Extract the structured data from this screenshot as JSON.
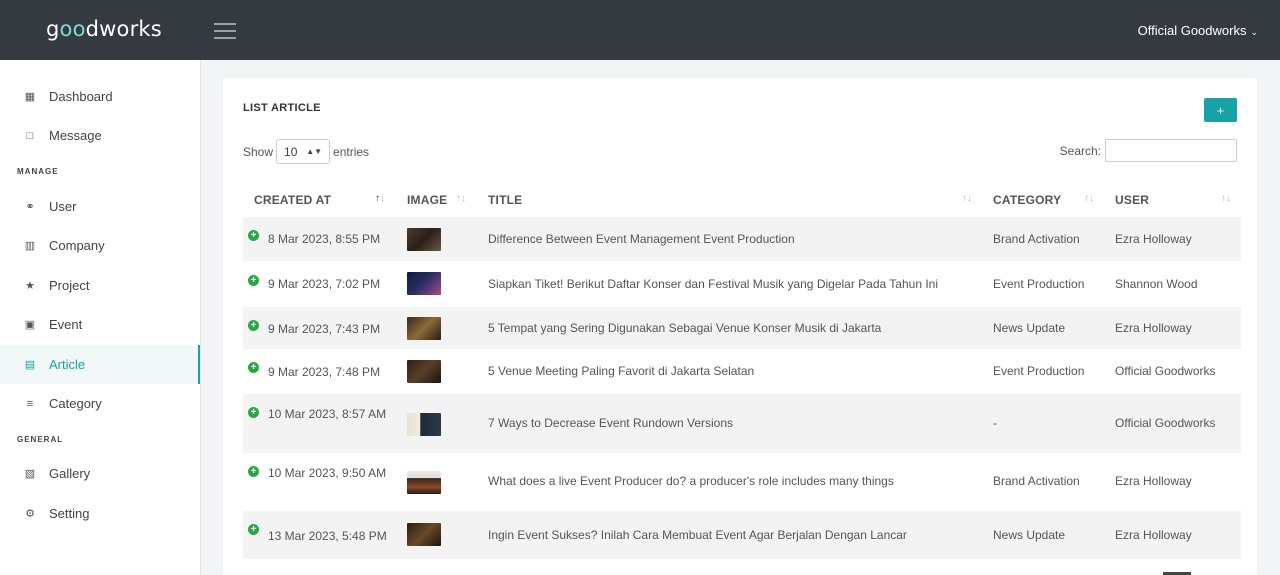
{
  "app": {
    "logo_prefix": "g",
    "logo_oo": "oo",
    "logo_suffix": "dworks",
    "account_name": "Official Goodworks"
  },
  "sidebar": {
    "items_top": [
      {
        "label": "Dashboard",
        "icon": "dashboard-icon"
      },
      {
        "label": "Message",
        "icon": "message-icon"
      }
    ],
    "manage_label": "MANAGE",
    "manage_items": [
      {
        "label": "User",
        "icon": "user-icon"
      },
      {
        "label": "Company",
        "icon": "company-icon"
      },
      {
        "label": "Project",
        "icon": "star-icon"
      },
      {
        "label": "Event",
        "icon": "calendar-icon"
      },
      {
        "label": "Article",
        "icon": "article-icon",
        "active": true
      },
      {
        "label": "Category",
        "icon": "list-icon"
      }
    ],
    "general_label": "GENERAL",
    "general_items": [
      {
        "label": "Gallery",
        "icon": "gallery-icon"
      },
      {
        "label": "Setting",
        "icon": "gear-icon"
      }
    ]
  },
  "main": {
    "title": "LIST ARTICLE",
    "add_label": "+",
    "show_label": "Show",
    "entries_value": "10",
    "entries_label": "entries",
    "search_label": "Search:",
    "search_value": "",
    "columns": [
      "CREATED AT",
      "IMAGE",
      "TITLE",
      "CATEGORY",
      "USER"
    ],
    "rows": [
      {
        "created_at": "8 Mar 2023, 8:55 PM",
        "title": "Difference Between Event Management Event Production",
        "category": "Brand Activation",
        "user": "Ezra Holloway"
      },
      {
        "created_at": "9 Mar 2023, 7:02 PM",
        "title": "Siapkan Tiket! Berikut Daftar Konser dan Festival Musik yang Digelar Pada Tahun Ini",
        "category": "Event Production",
        "user": "Shannon Wood"
      },
      {
        "created_at": "9 Mar 2023, 7:43 PM",
        "title": "5 Tempat yang Sering Digunakan Sebagai Venue Konser Musik di Jakarta",
        "category": "News Update",
        "user": "Ezra Holloway"
      },
      {
        "created_at": "9 Mar 2023, 7:48 PM",
        "title": "5 Venue Meeting Paling Favorit di Jakarta Selatan",
        "category": "Event Production",
        "user": "Official Goodworks"
      },
      {
        "created_at": "10 Mar 2023, 8:57 AM",
        "title": "7 Ways to Decrease Event Rundown Versions",
        "category": "-",
        "user": "Official Goodworks"
      },
      {
        "created_at": "10 Mar 2023, 9:50 AM",
        "title": "What does a live Event Producer do? a producer's role includes many things",
        "category": "Brand Activation",
        "user": "Ezra Holloway"
      },
      {
        "created_at": "13 Mar 2023, 5:48 PM",
        "title": "Ingin Event Sukses? Inilah Cara Membuat Event Agar Berjalan Dengan Lancar",
        "category": "News Update",
        "user": "Ezra Holloway"
      }
    ]
  },
  "colors": {
    "accent": "#17a2a5",
    "topbar": "#343a40",
    "expand": "#28a745"
  }
}
